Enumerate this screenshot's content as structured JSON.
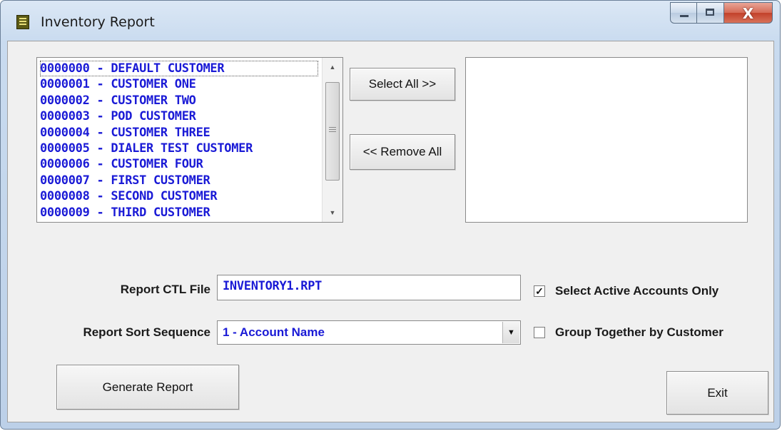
{
  "window": {
    "title": "Inventory Report",
    "icon": "report-book-icon",
    "caption_min": "–",
    "caption_max": "□",
    "caption_close": "X"
  },
  "customer_list": {
    "items": [
      "0000000 - DEFAULT CUSTOMER",
      "0000001 - CUSTOMER ONE",
      "0000002 - CUSTOMER TWO",
      "0000003 - POD CUSTOMER",
      "0000004 - CUSTOMER THREE",
      "0000005 - DIALER TEST CUSTOMER",
      "0000006 - CUSTOMER FOUR",
      "0000007 - FIRST CUSTOMER",
      "0000008 - SECOND CUSTOMER",
      "0000009 - THIRD CUSTOMER"
    ],
    "scroll_up": "▲",
    "scroll_down": "▼"
  },
  "buttons": {
    "select_all": "Select All >>",
    "remove_all": "<< Remove All",
    "generate_report": "Generate Report",
    "exit": "Exit"
  },
  "selected_list": {
    "items": []
  },
  "form": {
    "ctl_file_label": "Report CTL File",
    "ctl_file_value": "INVENTORY1.RPT",
    "sort_label": "Report Sort Sequence",
    "sort_value": "1 - Account Name",
    "sort_dropdown_arrow": "▼",
    "active_only_label": "Select Active Accounts Only",
    "active_only_checked": true,
    "active_only_mark": "✓",
    "group_by_customer_label": "Group Together by Customer",
    "group_by_customer_checked": false
  },
  "colors": {
    "list_text": "#1a1ad6",
    "window_bg": "#f0f0f0",
    "close_button": "#c2412a"
  }
}
